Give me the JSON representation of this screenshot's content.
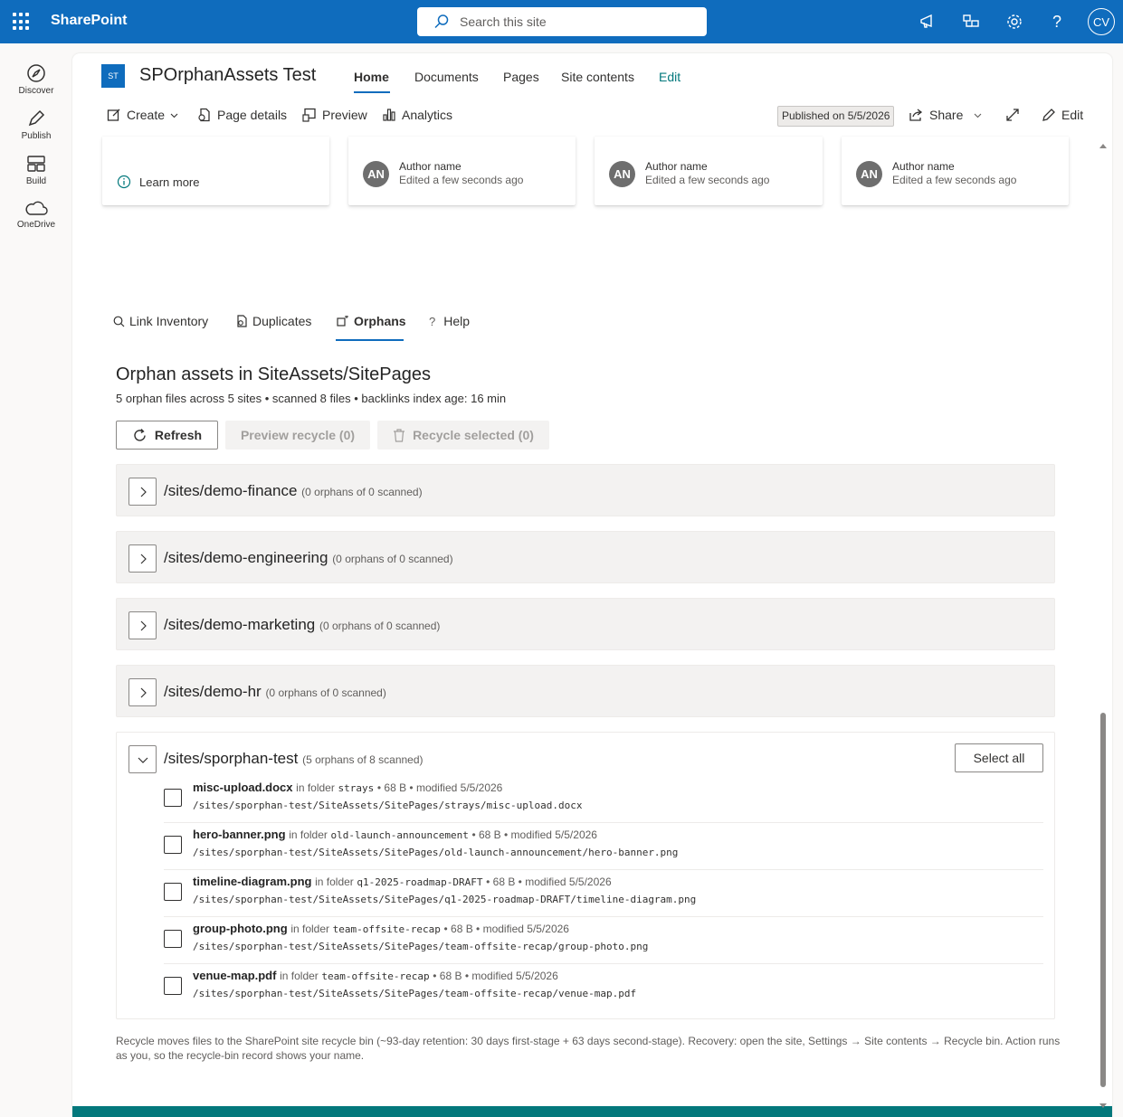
{
  "suite": {
    "brand": "SharePoint",
    "search_placeholder": "Search this site",
    "user_initials": "CV"
  },
  "leftnav": {
    "items": [
      {
        "label": "Discover",
        "icon": "compass-icon"
      },
      {
        "label": "Publish",
        "icon": "pen-icon"
      },
      {
        "label": "Build",
        "icon": "layout-icon"
      },
      {
        "label": "OneDrive",
        "icon": "cloud-icon"
      }
    ]
  },
  "site": {
    "logo": "ST",
    "title": "SPOrphanAssets Test",
    "nav": [
      "Home",
      "Documents",
      "Pages",
      "Site contents",
      "Edit"
    ],
    "active_nav": "Home"
  },
  "commandbar": {
    "create": "Create",
    "page_details": "Page details",
    "preview": "Preview",
    "analytics": "Analytics",
    "published": "Published on 5/5/2026",
    "share": "Share",
    "edit": "Edit"
  },
  "cards": {
    "learn_more": "Learn more",
    "author_initials": "AN",
    "author_name": "Author name",
    "edited": "Edited a few seconds ago"
  },
  "tabs": {
    "items": [
      "Link Inventory",
      "Duplicates",
      "Orphans",
      "Help"
    ],
    "active": "Orphans"
  },
  "orphans": {
    "title": "Orphan assets in SiteAssets/SitePages",
    "summary": "5 orphan files across 5 sites • scanned 8 files • backlinks index age: 16 min",
    "refresh": "Refresh",
    "preview_recycle": "Preview recycle (0)",
    "recycle_selected": "Recycle selected (0)",
    "select_all": "Select all",
    "groups": [
      {
        "site": "/sites/demo-finance",
        "meta": "(0 orphans of 0 scanned)"
      },
      {
        "site": "/sites/demo-engineering",
        "meta": "(0 orphans of 0 scanned)"
      },
      {
        "site": "/sites/demo-marketing",
        "meta": "(0 orphans of 0 scanned)"
      },
      {
        "site": "/sites/demo-hr",
        "meta": "(0 orphans of 0 scanned)"
      },
      {
        "site": "/sites/sporphan-test",
        "meta": "(5 orphans of 8 scanned)"
      }
    ],
    "files": [
      {
        "name": "misc-upload.docx",
        "in_folder": "in folder",
        "folder": "strays",
        "details": "• 68 B • modified 5/5/2026",
        "path": "/sites/sporphan-test/SiteAssets/SitePages/strays/misc-upload.docx"
      },
      {
        "name": "hero-banner.png",
        "in_folder": "in folder",
        "folder": "old-launch-announcement",
        "details": "• 68 B • modified 5/5/2026",
        "path": "/sites/sporphan-test/SiteAssets/SitePages/old-launch-announcement/hero-banner.png"
      },
      {
        "name": "timeline-diagram.png",
        "in_folder": "in folder",
        "folder": "q1-2025-roadmap-DRAFT",
        "details": "• 68 B • modified 5/5/2026",
        "path": "/sites/sporphan-test/SiteAssets/SitePages/q1-2025-roadmap-DRAFT/timeline-diagram.png"
      },
      {
        "name": "group-photo.png",
        "in_folder": "in folder",
        "folder": "team-offsite-recap",
        "details": "• 68 B • modified 5/5/2026",
        "path": "/sites/sporphan-test/SiteAssets/SitePages/team-offsite-recap/group-photo.png"
      },
      {
        "name": "venue-map.pdf",
        "in_folder": "in folder",
        "folder": "team-offsite-recap",
        "details": "• 68 B • modified 5/5/2026",
        "path": "/sites/sporphan-test/SiteAssets/SitePages/team-offsite-recap/venue-map.pdf"
      }
    ],
    "footnote": "Recycle moves files to the SharePoint site recycle bin (~93-day retention: 30 days first-stage + 63 days second-stage). Recovery: open the site, Settings → Site contents → Recycle bin. Action runs as you, so the recycle-bin record shows your name."
  },
  "colors": {
    "brand_blue": "#0f6cbd",
    "footer_teal": "#03787c"
  }
}
